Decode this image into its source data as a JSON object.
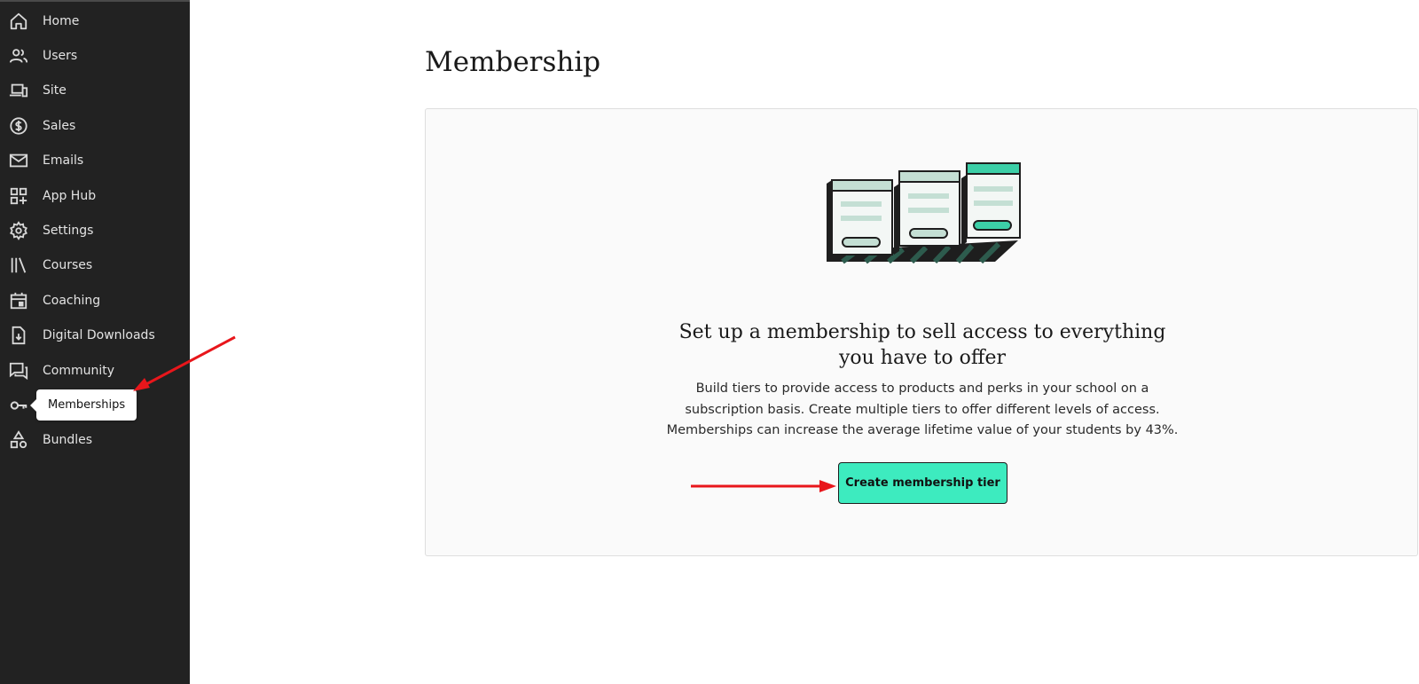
{
  "sidebar": {
    "items": [
      {
        "label": "Home",
        "icon": "home-icon"
      },
      {
        "label": "Users",
        "icon": "users-icon"
      },
      {
        "label": "Site",
        "icon": "devices-icon"
      },
      {
        "label": "Sales",
        "icon": "dollar-icon"
      },
      {
        "label": "Emails",
        "icon": "mail-icon"
      },
      {
        "label": "App Hub",
        "icon": "apps-icon"
      },
      {
        "label": "Settings",
        "icon": "gear-icon"
      },
      {
        "label": "Courses",
        "icon": "library-icon"
      },
      {
        "label": "Coaching",
        "icon": "calendar-icon"
      },
      {
        "label": "Digital Downloads",
        "icon": "download-file-icon"
      },
      {
        "label": "Community",
        "icon": "chat-icon"
      },
      {
        "label": "",
        "icon": "key-icon"
      },
      {
        "label": "Bundles",
        "icon": "shapes-icon"
      }
    ],
    "tooltip": "Memberships"
  },
  "main": {
    "title": "Membership",
    "card": {
      "headline": "Set up a membership to sell access to everything you have to offer",
      "description": "Build tiers to provide access to products and perks in your school on a subscription basis. Create multiple tiers to offer different levels of access. Memberships can increase the average lifetime value of your students by 43%.",
      "cta_label": "Create membership tier"
    }
  },
  "colors": {
    "sidebar_bg": "#222222",
    "accent": "#3debbf",
    "annotation_arrow": "#e8161b"
  }
}
